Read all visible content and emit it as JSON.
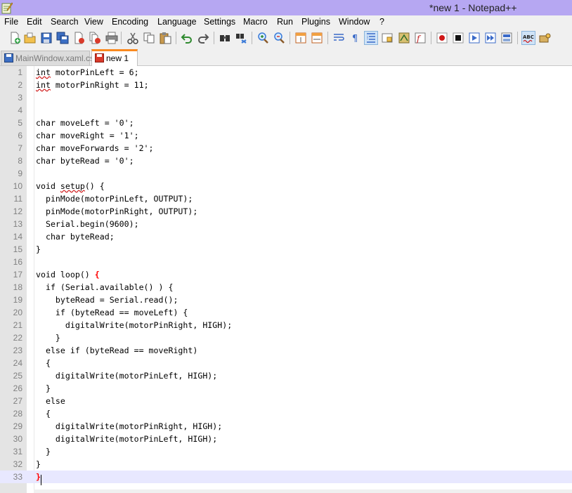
{
  "window": {
    "title": "*new  1 - Notepad++"
  },
  "menu": [
    "File",
    "Edit",
    "Search",
    "View",
    "Encoding",
    "Language",
    "Settings",
    "Macro",
    "Run",
    "Plugins",
    "Window",
    "?"
  ],
  "tabs": [
    {
      "label": "MainWindow.xaml.cs",
      "active": false
    },
    {
      "label": "new  1",
      "active": true
    }
  ],
  "toolbar_icons": [
    "new-file-icon",
    "open-file-icon",
    "save-icon",
    "save-all-icon",
    "close-icon",
    "close-all-icon",
    "print-icon",
    "cut-icon",
    "copy-icon",
    "paste-icon",
    "undo-icon",
    "redo-icon",
    "find-icon",
    "replace-icon",
    "zoom-in-icon",
    "zoom-out-icon",
    "sync-vertical-icon",
    "sync-horizontal-icon",
    "word-wrap-icon",
    "show-all-chars-icon",
    "indent-guide-icon",
    "user-defined-lang-icon",
    "doc-map-icon",
    "function-list-icon",
    "record-macro-icon",
    "stop-record-icon",
    "play-macro-icon",
    "run-macro-multiple-icon",
    "save-macro-icon",
    "spellcheck-icon",
    "plugin-icon"
  ],
  "editor": {
    "current_line": 33,
    "lines": [
      "int motorPinLeft = 6;",
      "int motorPinRight = 11;",
      "",
      "",
      "char moveLeft = '0';",
      "char moveRight = '1';",
      "char moveForwards = '2';",
      "char byteRead = '0';",
      "",
      "void setup() {",
      "  pinMode(motorPinLeft, OUTPUT);",
      "  pinMode(motorPinRight, OUTPUT);",
      "  Serial.begin(9600);",
      "  char byteRead;",
      "}",
      "",
      "void loop() {",
      "  if (Serial.available() ) {",
      "    byteRead = Serial.read();",
      "    if (byteRead == moveLeft) {",
      "      digitalWrite(motorPinRight, HIGH);",
      "    }",
      "  else if (byteRead == moveRight)",
      "  {",
      "    digitalWrite(motorPinLeft, HIGH);",
      "  }",
      "  else",
      "  {",
      "    digitalWrite(motorPinRight, HIGH);",
      "    digitalWrite(motorPinLeft, HIGH);",
      "  }",
      "}",
      "}"
    ]
  },
  "colors": {
    "titlebar": "#b6a7f2",
    "tab_accent": "#fa8a20",
    "current_line": "#e8e8ff",
    "brace_highlight": "#ff0000",
    "spell_error": "#d01818"
  }
}
